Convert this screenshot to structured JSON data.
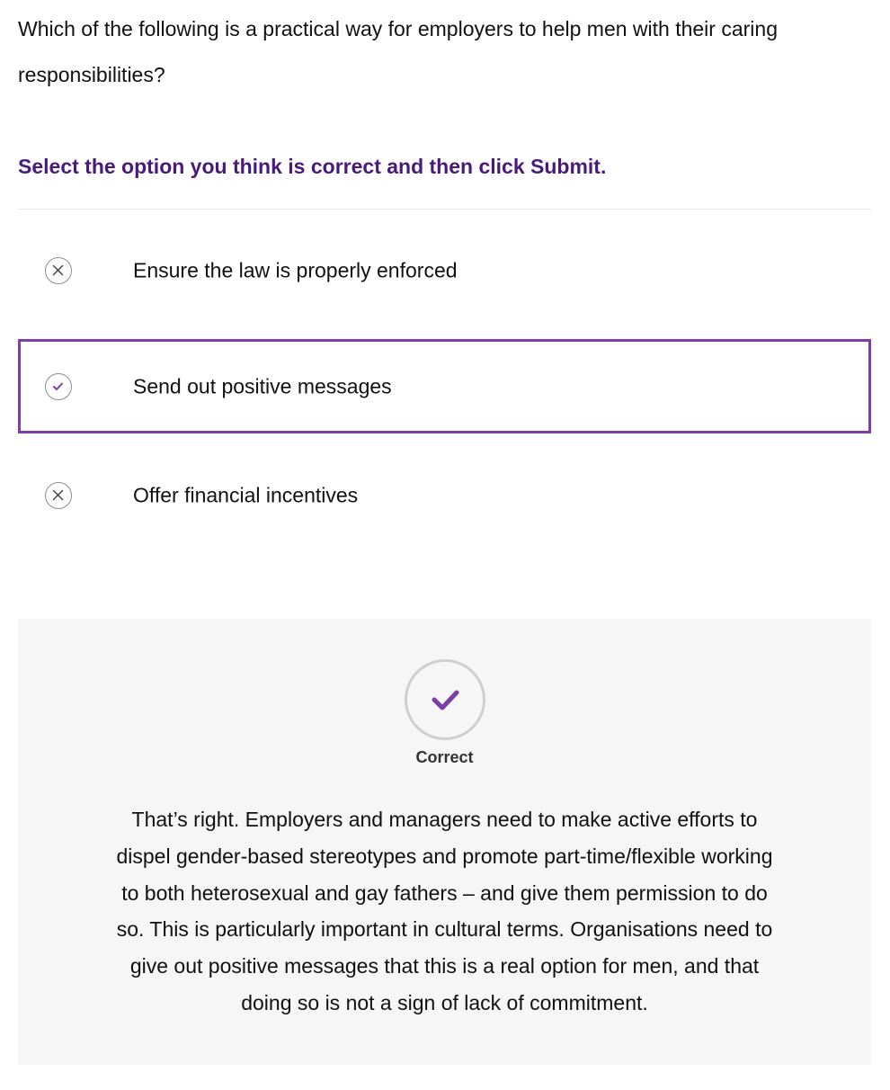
{
  "question": {
    "text": "Which of the following is a practical way for employers to help men with their caring responsibilities?"
  },
  "instruction": "Select the option you think is correct and then click Submit.",
  "options": [
    {
      "label": "Ensure the law is properly enforced",
      "state": "incorrect",
      "icon": "close-icon"
    },
    {
      "label": "Send out positive messages",
      "state": "correct",
      "selected": true,
      "icon": "check-icon"
    },
    {
      "label": "Offer financial incentives",
      "state": "incorrect",
      "icon": "close-icon"
    }
  ],
  "feedback": {
    "status": "Correct",
    "icon": "check-icon",
    "text": "That’s right. Employers and managers need to make active efforts to dispel gender-based stereotypes and promote part-time/flexible working to both heterosexual and gay fathers – and give them permission to do so. This is particularly important in cultural terms. Organisations need to give out positive messages that this is a real option for men, and that doing so is not a sign of lack of commitment."
  },
  "colors": {
    "accent": "#7b3fa6",
    "instruction": "#4a1a7a",
    "feedback_bg": "#f6f6f6"
  }
}
